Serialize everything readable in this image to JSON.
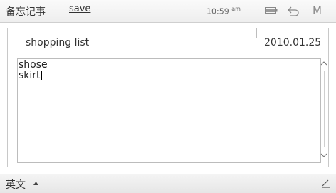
{
  "status_bar": {
    "app_title": "备忘记事",
    "save_label": "save",
    "time": "10:59",
    "ampm": "am",
    "battery_icon": "battery-icon",
    "back_icon": "back-arrow-icon",
    "menu_label": "M"
  },
  "memo": {
    "title": "shopping list",
    "date": "2010.01.25",
    "lines": [
      "shose",
      "skirt"
    ],
    "scroll_up_icon": "chevron-up-icon",
    "scroll_down_icon": "chevron-down-icon"
  },
  "bottom_bar": {
    "input_method": "英文",
    "input_method_icon": "triangle-up-icon",
    "pen_icon": "pen-icon"
  },
  "colors": {
    "text": "#333333",
    "border": "#c8c8c8",
    "bar_background": "#eeeeee"
  }
}
